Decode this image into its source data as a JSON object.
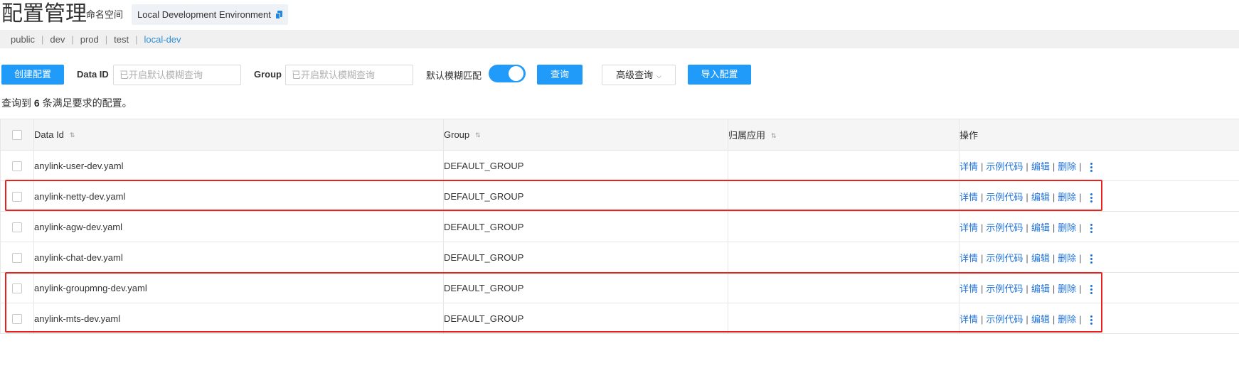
{
  "page": {
    "title": "配置管理",
    "namespace_label": "命名空间",
    "namespace_value": "Local Development Environment"
  },
  "namespaces": [
    {
      "label": "public",
      "active": false
    },
    {
      "label": "dev",
      "active": false
    },
    {
      "label": "prod",
      "active": false
    },
    {
      "label": "test",
      "active": false
    },
    {
      "label": "local-dev",
      "active": true
    }
  ],
  "toolbar": {
    "create_label": "创建配置",
    "dataid_label": "Data ID",
    "dataid_placeholder": "已开启默认模糊查询",
    "group_label": "Group",
    "group_placeholder": "已开启默认模糊查询",
    "fuzzy_label": "默认模糊匹配",
    "fuzzy_enabled": true,
    "query_label": "查询",
    "advanced_label": "高级查询",
    "import_label": "导入配置"
  },
  "summary": {
    "prefix": "查询到",
    "count": "6",
    "suffix": "条满足要求的配置。"
  },
  "table": {
    "columns": [
      "Data Id",
      "Group",
      "归属应用",
      "操作"
    ],
    "actions": [
      "详情",
      "示例代码",
      "编辑",
      "删除"
    ],
    "rows": [
      {
        "data_id": "anylink-user-dev.yaml",
        "group": "DEFAULT_GROUP",
        "app": ""
      },
      {
        "data_id": "anylink-netty-dev.yaml",
        "group": "DEFAULT_GROUP",
        "app": ""
      },
      {
        "data_id": "anylink-agw-dev.yaml",
        "group": "DEFAULT_GROUP",
        "app": ""
      },
      {
        "data_id": "anylink-chat-dev.yaml",
        "group": "DEFAULT_GROUP",
        "app": ""
      },
      {
        "data_id": "anylink-groupmng-dev.yaml",
        "group": "DEFAULT_GROUP",
        "app": ""
      },
      {
        "data_id": "anylink-mts-dev.yaml",
        "group": "DEFAULT_GROUP",
        "app": ""
      }
    ]
  },
  "colors": {
    "primary": "#209bfa",
    "link": "#1f72d9",
    "active_namespace": "#2f8fd8",
    "highlight": "#e8211c"
  }
}
